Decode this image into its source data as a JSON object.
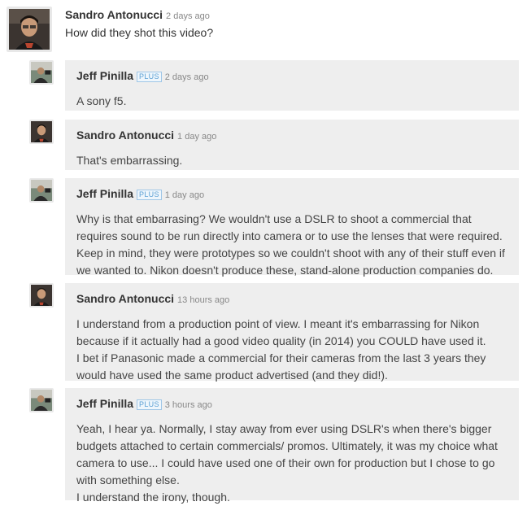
{
  "thread": {
    "top": {
      "author": "Sandro Antonucci",
      "time": "2 days ago",
      "text": "How did they shot this video?"
    },
    "replies": [
      {
        "author": "Jeff Pinilla",
        "badge": "PLUS",
        "time": "2 days ago",
        "text": "A sony f5."
      },
      {
        "author": "Sandro Antonucci",
        "time": "1 day ago",
        "text": "That's embarrassing."
      },
      {
        "author": "Jeff Pinilla",
        "badge": "PLUS",
        "time": "1 day ago",
        "text": "Why is that embarrasing? We wouldn't use a DSLR to shoot a commercial that\nrequires sound to be run directly into camera or to use the lenses that were required.\nKeep in mind, they were prototypes so we couldn't shoot with any of their stuff even if\nwe wanted to. Nikon doesn't produce these, stand-alone production companies do."
      },
      {
        "author": "Sandro Antonucci",
        "time": "13 hours ago",
        "text": "I understand from a production point of view. I meant it's embarrassing for Nikon\nbecause if it actually had a good video quality (in 2014) you COULD have used it.\nI bet if Panasonic made a commercial for their cameras from the last 3 years they\nwould have used the same product advertised (and they did!)."
      },
      {
        "author": "Jeff Pinilla",
        "badge": "PLUS",
        "time": "3 hours ago",
        "text": "Yeah, I hear ya. Normally, I stay away from ever using DSLR's when there's bigger\nbudgets attached to certain commercials/ promos. Ultimately, it was my choice what\ncamera to use... I could have used one of their own for production but I chose to go\nwith something else.\nI understand the irony, though."
      }
    ]
  }
}
